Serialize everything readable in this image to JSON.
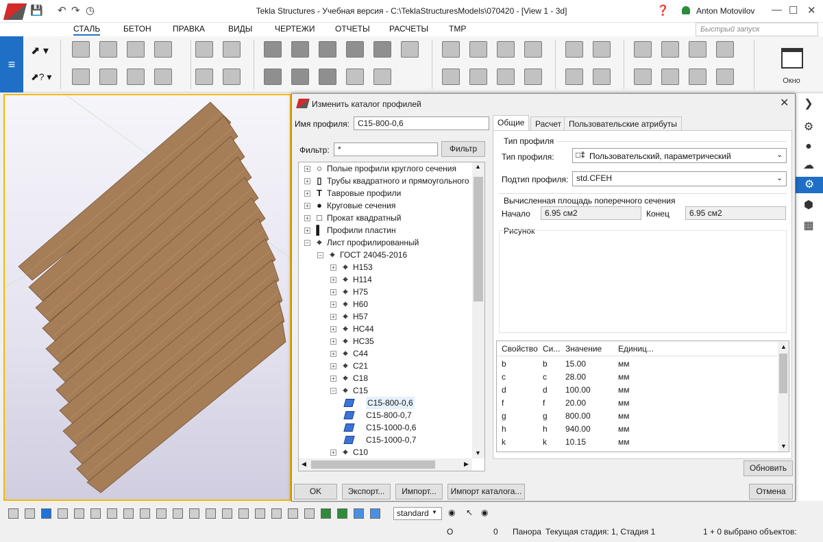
{
  "app": {
    "title": "Tekla Structures - Учебная версия - C:\\TeklaStructuresModels\\070420  - [View 1 - 3d]",
    "user": "Anton Motovilov",
    "quick_launch_placeholder": "Быстрый запуск",
    "menu": [
      "СТАЛЬ",
      "БЕТОН",
      "ПРАВКА",
      "ВИДЫ",
      "ЧЕРТЕЖИ",
      "ОТЧЕТЫ",
      "РАСЧЕТЫ",
      "TMP"
    ],
    "active_menu": "СТАЛЬ",
    "window_button_label": "Окно"
  },
  "dialog": {
    "title": "Изменить каталог профилей",
    "profile_name_label": "Имя профиля:",
    "profile_name_value": "C15-800-0,6",
    "filter_label": "Фильтр:",
    "filter_value": "*",
    "filter_button": "Фильтр",
    "tree": [
      {
        "label": "Полые профили круглого сечения",
        "icon": "hollow-circle-icon",
        "level": 0,
        "expander": "+"
      },
      {
        "label": "Трубы квадратного и прямоугольного",
        "icon": "rect-tube-icon",
        "level": 0,
        "expander": "+"
      },
      {
        "label": "Тавровые профили",
        "icon": "t-profile-icon",
        "level": 0,
        "expander": "+"
      },
      {
        "label": "Круговые сечения",
        "icon": "solid-circle-icon",
        "level": 0,
        "expander": "+"
      },
      {
        "label": "Прокат квадратный",
        "icon": "square-bar-icon",
        "level": 0,
        "expander": "+"
      },
      {
        "label": "Профили пластин",
        "icon": "plate-icon",
        "level": 0,
        "expander": "+"
      },
      {
        "label": "Лист профилированный",
        "icon": "profiled-sheet-icon",
        "level": 0,
        "expander": "−"
      },
      {
        "label": "ГОСТ 24045-2016",
        "icon": "profiled-sheet-icon",
        "level": 1,
        "expander": "−"
      },
      {
        "label": "H153",
        "icon": "profiled-sheet-icon",
        "level": 2,
        "expander": "+"
      },
      {
        "label": "H114",
        "icon": "profiled-sheet-icon",
        "level": 2,
        "expander": "+"
      },
      {
        "label": "H75",
        "icon": "profiled-sheet-icon",
        "level": 2,
        "expander": "+"
      },
      {
        "label": "H60",
        "icon": "profiled-sheet-icon",
        "level": 2,
        "expander": "+"
      },
      {
        "label": "H57",
        "icon": "profiled-sheet-icon",
        "level": 2,
        "expander": "+"
      },
      {
        "label": "HC44",
        "icon": "profiled-sheet-icon",
        "level": 2,
        "expander": "+"
      },
      {
        "label": "HC35",
        "icon": "profiled-sheet-icon",
        "level": 2,
        "expander": "+"
      },
      {
        "label": "C44",
        "icon": "profiled-sheet-icon",
        "level": 2,
        "expander": "+"
      },
      {
        "label": "C21",
        "icon": "profiled-sheet-icon",
        "level": 2,
        "expander": "+"
      },
      {
        "label": "C18",
        "icon": "profiled-sheet-icon",
        "level": 2,
        "expander": "+"
      },
      {
        "label": "C15",
        "icon": "profiled-sheet-icon",
        "level": 2,
        "expander": "−"
      },
      {
        "label": "C15-800-0,6",
        "icon": "profile-leaf-icon",
        "level": 3,
        "expander": "",
        "selected": true
      },
      {
        "label": "C15-800-0,7",
        "icon": "profile-leaf-icon",
        "level": 3,
        "expander": ""
      },
      {
        "label": "C15-1000-0,6",
        "icon": "profile-leaf-icon",
        "level": 3,
        "expander": ""
      },
      {
        "label": "C15-1000-0,7",
        "icon": "profile-leaf-icon",
        "level": 3,
        "expander": ""
      },
      {
        "label": "C10",
        "icon": "profiled-sheet-icon",
        "level": 2,
        "expander": "+"
      }
    ],
    "tabs": [
      "Общие",
      "Расчет",
      "Пользовательские атрибуты"
    ],
    "active_tab": "Общие",
    "profile_type_group": "Тип профиля",
    "profile_type_label": "Тип профиля:",
    "profile_type_value": "Пользовательский, параметрический",
    "profile_subtype_label": "Подтип профиля:",
    "profile_subtype_value": "std.CFEH",
    "area_group": "Вычисленная площадь поперечного сечения",
    "start_label": "Начало",
    "start_value": "6.95 см2",
    "end_label": "Конец",
    "end_value": "6.95 см2",
    "picture_group": "Рисунок",
    "props_headers": [
      "Свойство",
      "Си...",
      "Значение",
      "Единиц..."
    ],
    "props": [
      [
        "b",
        "b",
        "15.00",
        "мм"
      ],
      [
        "c",
        "c",
        "28.00",
        "мм"
      ],
      [
        "d",
        "d",
        "100.00",
        "мм"
      ],
      [
        "f",
        "f",
        "20.00",
        "мм"
      ],
      [
        "g",
        "g",
        "800.00",
        "мм"
      ],
      [
        "h",
        "h",
        "940.00",
        "мм"
      ],
      [
        "k",
        "k",
        "10.15",
        "мм"
      ]
    ],
    "update_button": "Обновить",
    "ok_button": "OK",
    "export_button": "Экспорт...",
    "import_button": "Импорт...",
    "import_catalog_button": "Импорт каталога...",
    "cancel_button": "Отмена"
  },
  "statusbar": {
    "selection_filter": "standard",
    "o_label": "О",
    "zero": "0",
    "pan_label": "Панора",
    "stage": "Текущая стадия: 1, Стадия 1",
    "selected": "1 + 0 выбрано объектов:"
  }
}
